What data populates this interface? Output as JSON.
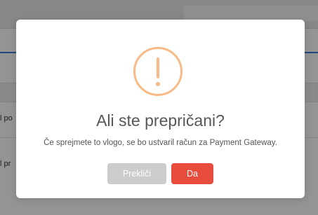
{
  "background": {
    "row_texts": [
      "l po",
      "l pr"
    ]
  },
  "dialog": {
    "icon": "warning-exclamation-icon",
    "icon_color": "#f8bb86",
    "title": "Ali ste prepričani?",
    "message": "Če sprejmete to vlogo, se bo ustvaril račun za Payment Gateway.",
    "cancel_label": "Prekliči",
    "cancel_color": "#cccccc",
    "confirm_label": "Da",
    "confirm_color": "#e74c3c"
  }
}
